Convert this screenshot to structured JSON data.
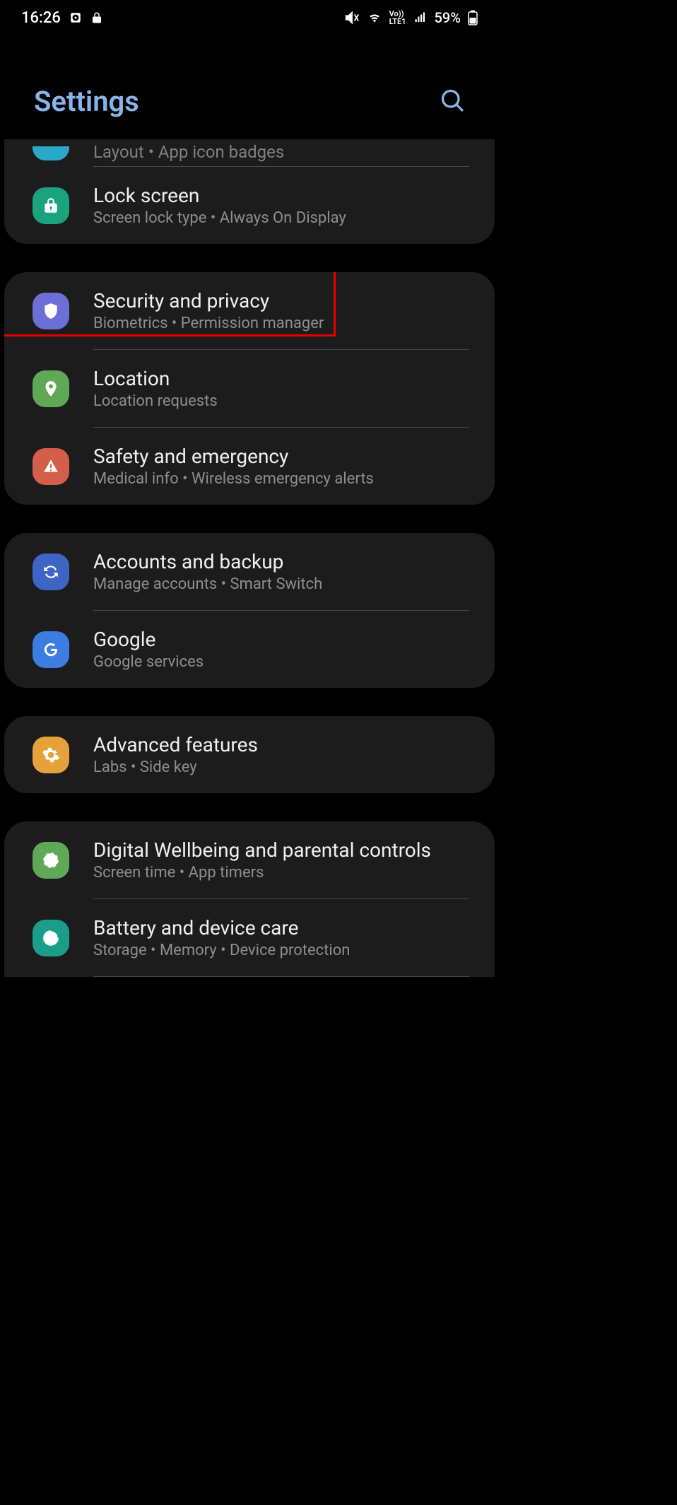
{
  "status_bar": {
    "time": "16:26",
    "battery_pct": "59%",
    "lte_label": "Vo))\nLTE1"
  },
  "header": {
    "title": "Settings"
  },
  "partial_row": {
    "subtitle": "Layout  •  App icon badges"
  },
  "groups": [
    {
      "id": "g0",
      "rows": [
        {
          "icon_bg": "#1aa37d",
          "icon_name": "lock-icon",
          "title": "Lock screen",
          "subtitle": "Screen lock type  •  Always On Display"
        }
      ]
    },
    {
      "id": "g1",
      "rows": [
        {
          "icon_bg": "#6b6fd6",
          "icon_name": "shield-icon",
          "title": "Security and privacy",
          "subtitle": "Biometrics  •  Permission manager",
          "highlight": true
        },
        {
          "icon_bg": "#5fa856",
          "icon_name": "pin-icon",
          "title": "Location",
          "subtitle": "Location requests"
        },
        {
          "icon_bg": "#d55e4a",
          "icon_name": "alert-icon",
          "title": "Safety and emergency",
          "subtitle": "Medical info  •  Wireless emergency alerts"
        }
      ]
    },
    {
      "id": "g2",
      "rows": [
        {
          "icon_bg": "#3e64c5",
          "icon_name": "sync-icon",
          "title": "Accounts and backup",
          "subtitle": "Manage accounts  •  Smart Switch"
        },
        {
          "icon_bg": "#3b7de0",
          "icon_name": "google-icon",
          "title": "Google",
          "subtitle": "Google services"
        }
      ]
    },
    {
      "id": "g3",
      "rows": [
        {
          "icon_bg": "#e6a13a",
          "icon_name": "gear-plus-icon",
          "title": "Advanced features",
          "subtitle": "Labs  •  Side key"
        }
      ]
    },
    {
      "id": "g4",
      "rows": [
        {
          "icon_bg": "#5fa856",
          "icon_name": "heart-circle-icon",
          "title": "Digital Wellbeing and parental controls",
          "subtitle": "Screen time  •  App timers"
        },
        {
          "icon_bg": "#1a9e8a",
          "icon_name": "device-care-icon",
          "title": "Battery and device care",
          "subtitle": "Storage  •  Memory  •  Device protection"
        }
      ]
    }
  ]
}
